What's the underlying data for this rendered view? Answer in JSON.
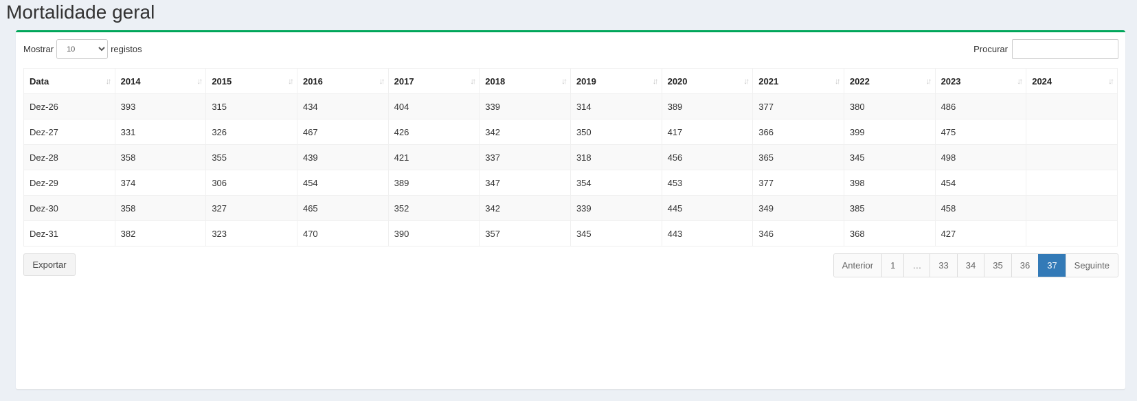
{
  "page": {
    "title": "Mortalidade geral"
  },
  "controls": {
    "show_label": "Mostrar",
    "page_size": "10",
    "records_label": "registos",
    "search_label": "Procurar",
    "search_value": ""
  },
  "table": {
    "headers": [
      "Data",
      "2014",
      "2015",
      "2016",
      "2017",
      "2018",
      "2019",
      "2020",
      "2021",
      "2022",
      "2023",
      "2024"
    ],
    "rows": [
      [
        "Dez-26",
        "393",
        "315",
        "434",
        "404",
        "339",
        "314",
        "389",
        "377",
        "380",
        "486",
        ""
      ],
      [
        "Dez-27",
        "331",
        "326",
        "467",
        "426",
        "342",
        "350",
        "417",
        "366",
        "399",
        "475",
        ""
      ],
      [
        "Dez-28",
        "358",
        "355",
        "439",
        "421",
        "337",
        "318",
        "456",
        "365",
        "345",
        "498",
        ""
      ],
      [
        "Dez-29",
        "374",
        "306",
        "454",
        "389",
        "347",
        "354",
        "453",
        "377",
        "398",
        "454",
        ""
      ],
      [
        "Dez-30",
        "358",
        "327",
        "465",
        "352",
        "342",
        "339",
        "445",
        "349",
        "385",
        "458",
        ""
      ],
      [
        "Dez-31",
        "382",
        "323",
        "470",
        "390",
        "357",
        "345",
        "443",
        "346",
        "368",
        "427",
        ""
      ]
    ]
  },
  "footer": {
    "export_label": "Exportar",
    "pagination": {
      "prev": "Anterior",
      "pages": [
        "1",
        "…",
        "33",
        "34",
        "35",
        "36",
        "37"
      ],
      "active": "37",
      "next": "Seguinte"
    }
  },
  "colors": {
    "accent": "#00a65a",
    "active_page": "#337ab7"
  }
}
